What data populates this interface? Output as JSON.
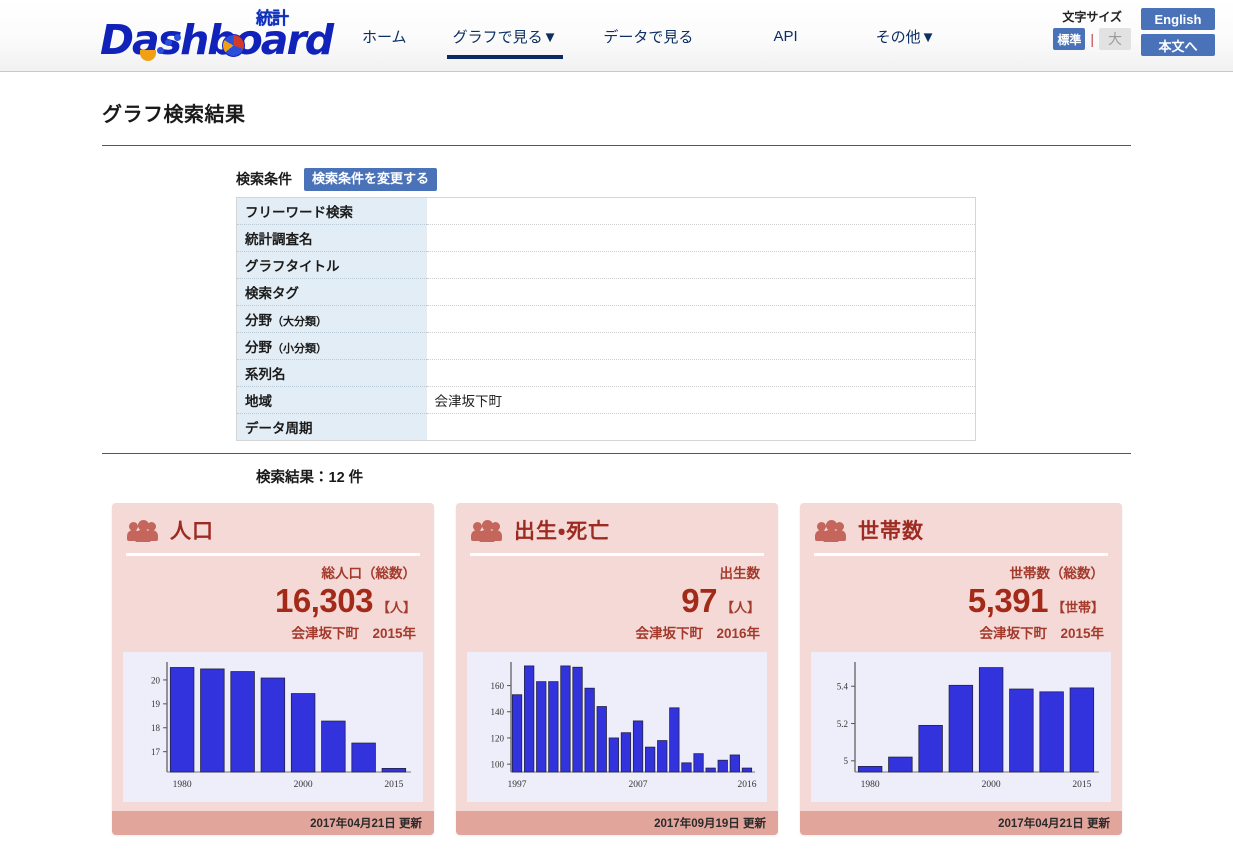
{
  "header": {
    "logo_text": "Dashboard",
    "logo_kanji": "統計",
    "nav": [
      {
        "label": "ホーム",
        "active": false
      },
      {
        "label": "グラフで見る▼",
        "active": true
      },
      {
        "label": "データで見る",
        "active": false
      },
      {
        "label": "API",
        "active": false
      },
      {
        "label": "その他▼",
        "active": false
      }
    ],
    "fontsize_label": "文字サイズ",
    "fontsize_standard": "標準",
    "fontsize_separator": "|",
    "fontsize_large": "大",
    "english_button": "English",
    "skip_button": "本文へ",
    "accent_blue": "#4a72b8",
    "nav_active_color": "#0a2a63"
  },
  "page": {
    "title": "グラフ検索結果"
  },
  "search_conditions": {
    "heading": "検索条件",
    "change_button": "検索条件を変更する",
    "rows": [
      {
        "label": "フリーワード検索",
        "sub": "",
        "value": ""
      },
      {
        "label": "統計調査名",
        "sub": "",
        "value": ""
      },
      {
        "label": "グラフタイトル",
        "sub": "",
        "value": ""
      },
      {
        "label": "検索タグ",
        "sub": "",
        "value": ""
      },
      {
        "label": "分野",
        "sub": "（大分類）",
        "value": ""
      },
      {
        "label": "分野",
        "sub": "（小分類）",
        "value": ""
      },
      {
        "label": "系列名",
        "sub": "",
        "value": ""
      },
      {
        "label": "地域",
        "sub": "",
        "value": "会津坂下町"
      },
      {
        "label": "データ周期",
        "sub": "",
        "value": ""
      }
    ]
  },
  "results": {
    "count_text": "検索結果：12 件",
    "count": 12
  },
  "cards": [
    {
      "icon": "people-icon",
      "title": "人口",
      "stat_label": "総人口（総数）",
      "stat_value": "16,303",
      "stat_unit": "【人】",
      "region": "会津坂下町　2015年",
      "updated": "2017年04月21日 更新"
    },
    {
      "icon": "people-icon",
      "title": "出生・死亡",
      "stat_label": "出生数",
      "stat_value": "97",
      "stat_unit": "【人】",
      "region": "会津坂下町　2016年",
      "updated": "2017年09月19日 更新"
    },
    {
      "icon": "people-icon",
      "title": "世帯数",
      "stat_label": "世帯数（総数）",
      "stat_value": "5,391",
      "stat_unit": "【世帯】",
      "region": "会津坂下町　2015年",
      "updated": "2017年04月21日 更新"
    }
  ],
  "chart_data": [
    {
      "type": "bar",
      "title": "総人口（総数）",
      "xlabel": "",
      "ylabel": "",
      "unit": "千人",
      "categories": [
        "1980",
        "1985",
        "1990",
        "1995",
        "2000",
        "2005",
        "2010",
        "2015"
      ],
      "tick_labels_shown": [
        "1980",
        "2000",
        "2015"
      ],
      "tick_label_positions": [
        0,
        4,
        7
      ],
      "values": [
        20.52,
        20.46,
        20.35,
        20.08,
        19.43,
        18.28,
        17.36,
        16.3
      ],
      "yticks": [
        17,
        18,
        19,
        20
      ],
      "ylim": [
        16.15,
        20.75
      ],
      "grid": false,
      "bar_color": "#3333dd",
      "plot_bg": "#eeeefa"
    },
    {
      "type": "bar",
      "title": "出生数",
      "xlabel": "",
      "ylabel": "",
      "unit": "人",
      "categories": [
        "1997",
        "1998",
        "1999",
        "2000",
        "2001",
        "2002",
        "2003",
        "2004",
        "2005",
        "2006",
        "2007",
        "2008",
        "2009",
        "2010",
        "2011",
        "2012",
        "2013",
        "2014",
        "2015",
        "2016"
      ],
      "tick_labels_shown": [
        "1997",
        "2007",
        "2016"
      ],
      "tick_label_positions": [
        0,
        10,
        19
      ],
      "values": [
        153,
        175,
        163,
        163,
        175,
        174,
        158,
        144,
        120,
        124,
        133,
        113,
        118,
        143,
        101,
        108,
        97,
        103,
        107,
        97
      ],
      "yticks": [
        100,
        120,
        140,
        160
      ],
      "ylim": [
        94,
        178
      ],
      "grid": false,
      "bar_color": "#3333dd",
      "plot_bg": "#eeeefa"
    },
    {
      "type": "bar",
      "title": "世帯数（総数）",
      "xlabel": "",
      "ylabel": "",
      "unit": "千世帯",
      "categories": [
        "1980",
        "1985",
        "1990",
        "1995",
        "2000",
        "2005",
        "2010",
        "2015"
      ],
      "tick_labels_shown": [
        "1980",
        "2000",
        "2015"
      ],
      "tick_label_positions": [
        0,
        4,
        7
      ],
      "values": [
        4.97,
        5.02,
        5.19,
        5.405,
        5.5,
        5.385,
        5.37,
        5.391
      ],
      "yticks": [
        5,
        5.2,
        5.4
      ],
      "ylim": [
        4.94,
        5.53
      ],
      "grid": false,
      "bar_color": "#3333dd",
      "plot_bg": "#eeeefa"
    }
  ]
}
